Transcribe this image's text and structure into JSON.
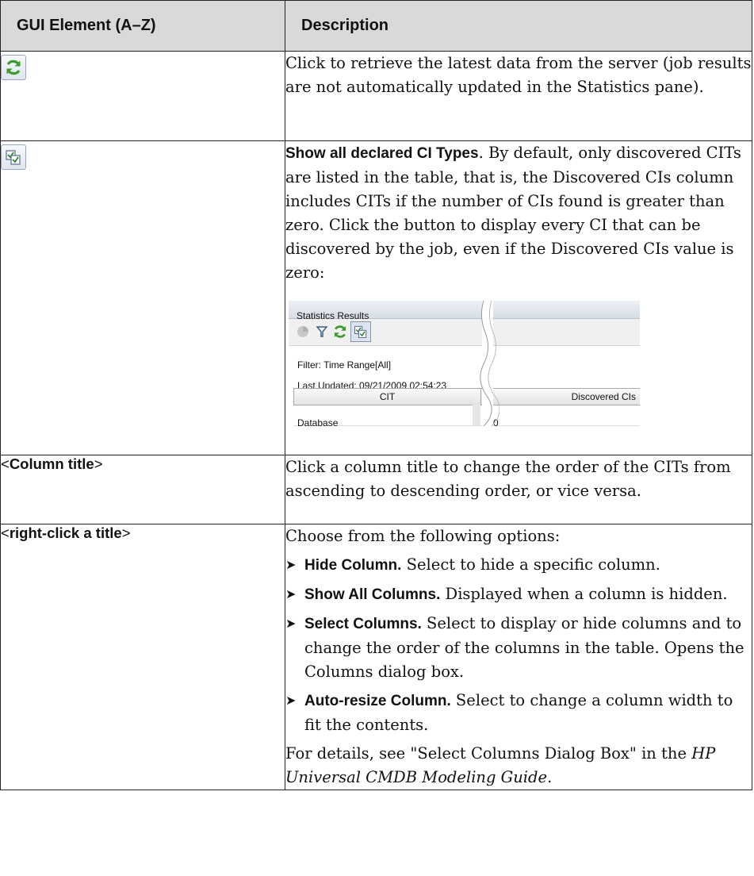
{
  "header": {
    "col1": "GUI Element (A–Z)",
    "col2": "Description"
  },
  "rows": [
    {
      "element": {
        "icon": "refresh-icon"
      },
      "desc": "Click to retrieve the latest data from the server (job results are not automatically updated in the Statistics pane)."
    },
    {
      "element": {
        "icon": "show-all-cit-icon"
      },
      "desc_bold": "Show all declared CI Types",
      "desc_rest": ". By default, only discovered CITs are listed in the table, that is, the Discovered CIs column includes CITs if the number of CIs found is greater than zero. Click the button to display every CI that can be discovered by the job, even if the Discovered CIs value is zero:",
      "screenshot": {
        "title": "Statistics Results",
        "filter": "Filter: Time Range[All]",
        "updated": "Last Updated: 09/21/2009 02:54:23",
        "col_cit": "CIT",
        "col_discovered": "Discovered CIs",
        "row_cit": "Database",
        "row_value": "0"
      }
    },
    {
      "element": {
        "lt": "<",
        "title": "Column title",
        "gt": ">"
      },
      "desc": "Click a column title to change the order of the CITs from ascending to descending order, or vice versa."
    },
    {
      "element": {
        "lt": "<",
        "title": "right-click a title",
        "gt": ">"
      },
      "intro": "Choose from the following options:",
      "bullets": [
        {
          "bold": "Hide Column.",
          "text": " Select to hide a specific column."
        },
        {
          "bold": "Show All Columns.",
          "text": " Displayed when a column is hidden."
        },
        {
          "bold": "Select Columns.",
          "text": " Select to display or hide columns and to change the order of the columns in the table. Opens the Columns dialog box."
        },
        {
          "bold": "Auto-resize Column.",
          "text": " Select to change a column width to fit the contents."
        }
      ],
      "details_pre": "For details, see \"Select Columns Dialog Box\" in the ",
      "details_ref": "HP Universal CMDB Modeling Guide",
      "details_post": "."
    }
  ],
  "bullet_glyph": "➤",
  "colors": {
    "header_bg": "#d9d9d9",
    "refresh_green": "#3a9a2a",
    "border": "#222222"
  }
}
